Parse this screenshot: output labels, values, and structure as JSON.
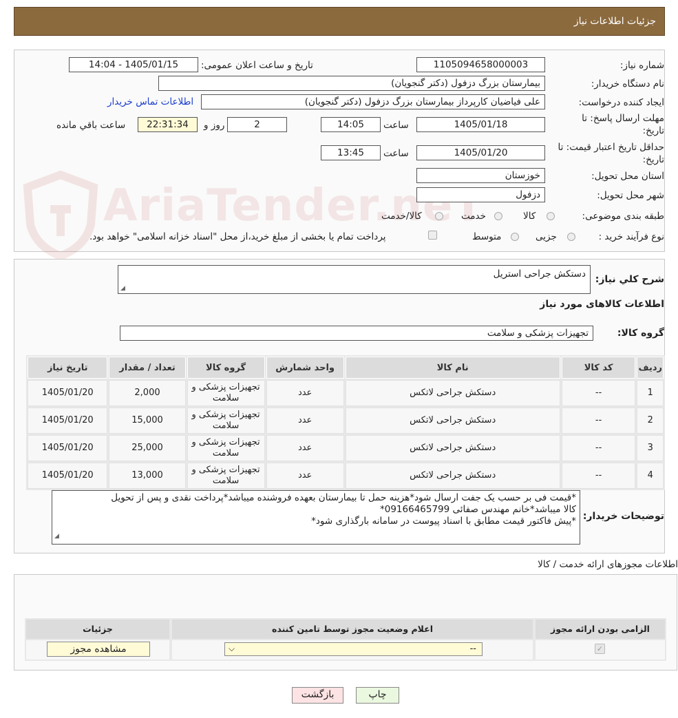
{
  "header": {
    "title": "جزئیات اطلاعات نیاز"
  },
  "info": {
    "need_number_label": "شماره نیاز:",
    "need_number": "1105094658000003",
    "announce_label": "تاریخ و ساعت اعلان عمومی:",
    "announce_value": "1405/01/15 - 14:04",
    "buyer_label": "نام دستگاه خریدار:",
    "buyer_value": "بیمارستان بزرگ دزفول (دکتر گنجویان)",
    "creator_label": "ایجاد کننده درخواست:",
    "creator_value": "علی فیاضیان کارپرداز بیمارستان بزرگ دزفول (دکتر گنجویان)",
    "contact_link": "اطلاعات تماس خریدار",
    "deadline_label_1": "مهلت ارسال پاسخ: تا",
    "deadline_label_2": "تاریخ:",
    "deadline_date": "1405/01/18",
    "time_label": "ساعت",
    "deadline_time": "14:05",
    "days_value": "2",
    "days_label": "روز و",
    "remaining_time": "22:31:34",
    "remaining_label": "ساعت باقي مانده",
    "validity_label_1": "حداقل تاریخ اعتبار قیمت: تا",
    "validity_label_2": "تاریخ:",
    "validity_date": "1405/01/20",
    "validity_time": "13:45",
    "province_label": "استان محل تحویل:",
    "province_value": "خوزستان",
    "city_label": "شهر محل تحویل:",
    "city_value": "دزفول",
    "category_label": "طبقه بندی موضوعی:",
    "category_options": [
      "کالا",
      "خدمت",
      "کالا/خدمت"
    ],
    "process_label": "نوع فرآیند خرید :",
    "process_options": [
      "جزیی",
      "متوسط"
    ],
    "payment_note": "پرداخت تمام یا بخشی از مبلغ خرید،از محل \"اسناد خزانه اسلامی\" خواهد بود."
  },
  "description": {
    "label": "شرح کلي نیاز:",
    "value": "دستکش جراحی استریل",
    "goods_title": "اطلاعات کالاهای مورد نیاز",
    "group_label": "گروه کالا:",
    "group_value": "تجهیزات پزشکی و سلامت"
  },
  "table": {
    "headers": [
      "ردیف",
      "کد کالا",
      "نام کالا",
      "واحد شمارش",
      "گروه کالا",
      "تعداد / مقدار",
      "تاریخ نیاز"
    ],
    "rows": [
      [
        "1",
        "--",
        "دستکش جراحی لاتکس",
        "عدد",
        "تجهیزات پزشکی و سلامت",
        "2,000",
        "1405/01/20"
      ],
      [
        "2",
        "--",
        "دستکش جراحی لاتکس",
        "عدد",
        "تجهیزات پزشکی و سلامت",
        "15,000",
        "1405/01/20"
      ],
      [
        "3",
        "--",
        "دستکش جراحی لاتکس",
        "عدد",
        "تجهیزات پزشکی و سلامت",
        "25,000",
        "1405/01/20"
      ],
      [
        "4",
        "--",
        "دستکش جراحی لاتکس",
        "عدد",
        "تجهیزات پزشکی و سلامت",
        "13,000",
        "1405/01/20"
      ]
    ]
  },
  "buyer_notes": {
    "label": "توضیحات خریدار:",
    "line1": "*قیمت فی بر حسب یک جفت ارسال شود*هزینه حمل تا بیمارستان بعهده فروشنده میباشد*پرداخت نقدی و پس از تحویل",
    "line2": "کالا میباشد*خانم مهندس صفائی 09166465799*",
    "line3": "*پیش فاکتور قیمت مطابق با اسناد پیوست در سامانه بارگذاری شود*"
  },
  "permits": {
    "title": "اطلاعات مجوزهای ارائه خدمت / کالا",
    "headers": [
      "الزامی بودن ارائه مجوز",
      "اعلام وضعیت مجوز توسط تامین کننده",
      "جزئیات"
    ],
    "select_value": "--",
    "view_button": "مشاهده مجوز"
  },
  "footer": {
    "print_button": "چاپ",
    "back_button": "بازگشت"
  },
  "watermark": "AriaTender.neT"
}
